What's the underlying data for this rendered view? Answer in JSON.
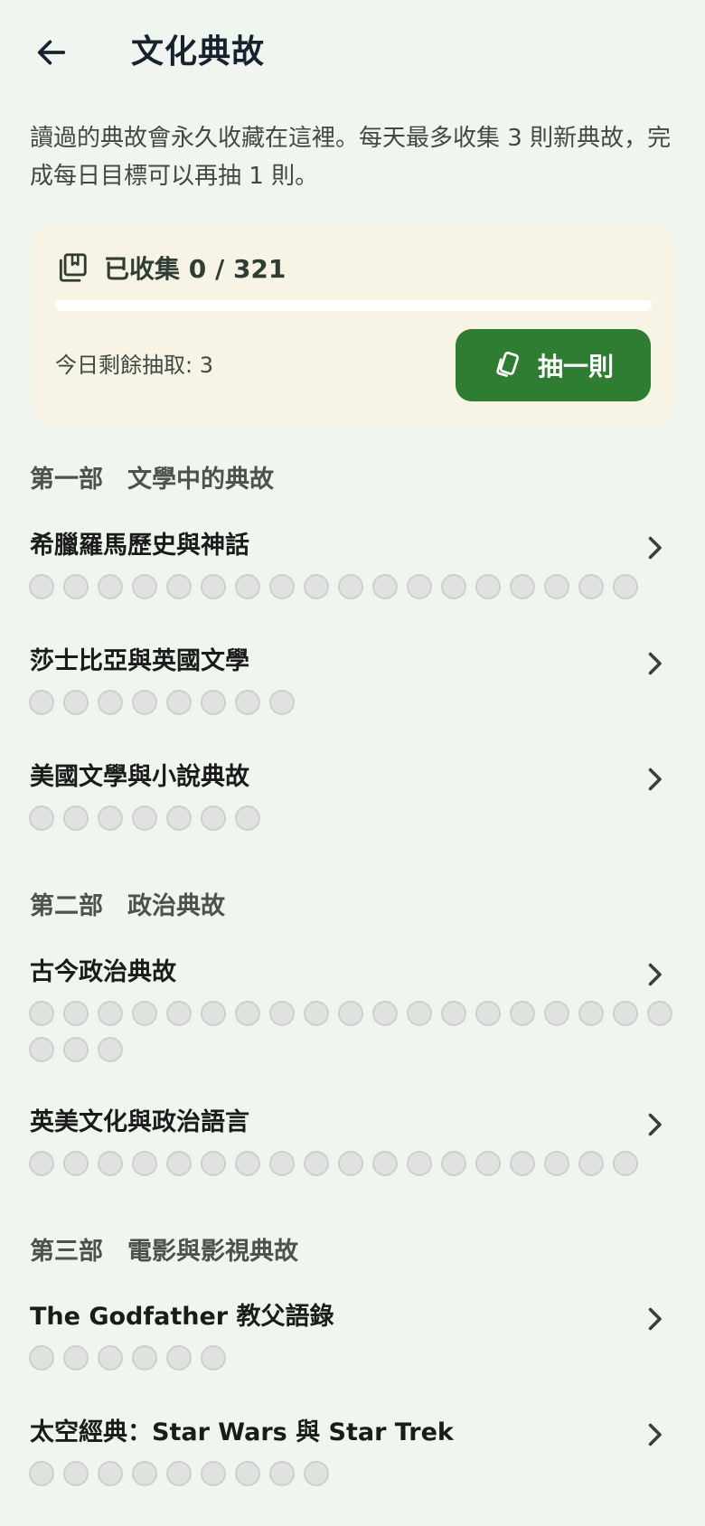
{
  "header": {
    "title": "文化典故",
    "back_icon": "arrow-left-icon"
  },
  "intro": "讀過的典故會永久收藏在這裡。每天最多收集 3 則新典故，完成每日目標可以再抽 1 則。",
  "summary": {
    "icon": "collection-icon",
    "collected_label": "已收集 0 / 321",
    "collected": 0,
    "total": 321,
    "progress": 0,
    "remaining_label": "今日剩餘抽取: 3",
    "draw_button": {
      "label": "抽一則",
      "icon": "card-icon"
    }
  },
  "colors": {
    "accent": "#2e7d32",
    "card_bg": "#f7f4e6",
    "page_bg": "#f0f5f0",
    "dot": "#e0e2e0"
  },
  "sections": [
    {
      "title": "第一部　文學中的典故",
      "categories": [
        {
          "title": "希臘羅馬歷史與神話",
          "count": 18
        },
        {
          "title": "莎士比亞與英國文學",
          "count": 8
        },
        {
          "title": "美國文學與小說典故",
          "count": 7
        }
      ]
    },
    {
      "title": "第二部　政治典故",
      "categories": [
        {
          "title": "古今政治典故",
          "count": 22
        },
        {
          "title": "英美文化與政治語言",
          "count": 18
        }
      ]
    },
    {
      "title": "第三部　電影與影視典故",
      "categories": [
        {
          "title": "The Godfather 教父語錄",
          "count": 6
        },
        {
          "title": "太空經典：Star Wars 與 Star Trek",
          "count": 9
        }
      ]
    }
  ]
}
